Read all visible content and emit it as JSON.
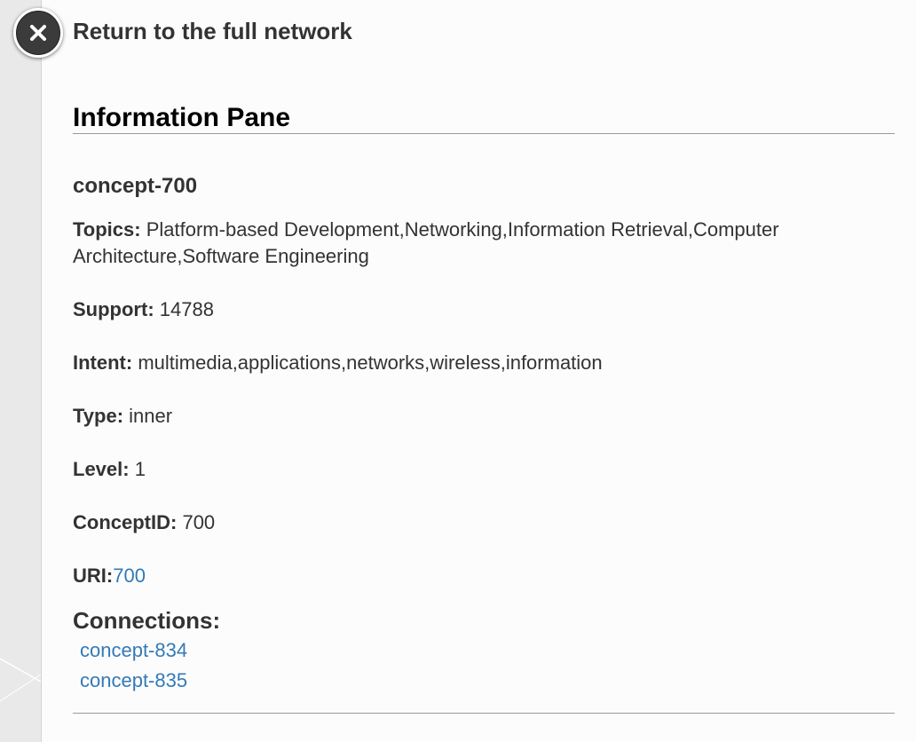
{
  "header": {
    "return_label": "Return to the full network"
  },
  "pane": {
    "title": "Information Pane",
    "concept_name": "concept-700"
  },
  "fields": {
    "topics": {
      "label": "Topics:",
      "value": "Platform-based Development,Networking,Information Retrieval,Computer Architecture,Software Engineering"
    },
    "support": {
      "label": "Support:",
      "value": "14788"
    },
    "intent": {
      "label": "Intent:",
      "value": "multimedia,applications,networks,wireless,information"
    },
    "type": {
      "label": "Type:",
      "value": "inner"
    },
    "level": {
      "label": "Level:",
      "value": "1"
    },
    "concept_id": {
      "label": "ConceptID:",
      "value": "700"
    },
    "uri": {
      "label": "URI:",
      "value": "700"
    }
  },
  "connections": {
    "title": "Connections:",
    "items": [
      {
        "label": "concept-834"
      },
      {
        "label": "concept-835"
      }
    ]
  },
  "icons": {
    "close": "close-icon"
  },
  "colors": {
    "link": "#337ab7",
    "text": "#333333",
    "title": "#000000",
    "panel_bg": "#fcfcfc"
  }
}
